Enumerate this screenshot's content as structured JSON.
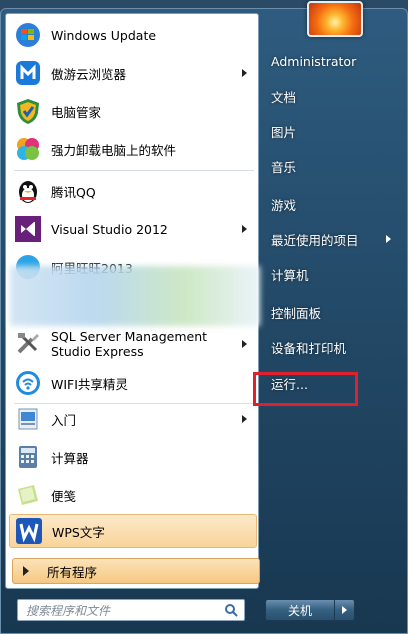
{
  "left_menu": {
    "items": [
      {
        "label": "Windows Update",
        "icon": "windows-update-icon"
      },
      {
        "label": "傲游云浏览器",
        "icon": "maxthon-browser-icon"
      },
      {
        "label": "电脑管家",
        "icon": "pc-manager-shield-icon"
      },
      {
        "label": "强力卸载电脑上的软件",
        "icon": "uninstall-petals-icon"
      },
      {
        "label": "腾讯QQ",
        "icon": "qq-penguin-icon"
      },
      {
        "label": "Visual Studio 2012",
        "icon": "visual-studio-icon"
      },
      {
        "label": "阿里旺旺2013",
        "icon": "aliwangwang-icon"
      },
      {
        "label": "SQL Server Management Studio Express",
        "icon": "sql-tools-icon"
      },
      {
        "label": "WIFI共享精灵",
        "icon": "wifi-share-icon"
      },
      {
        "label": "入门",
        "icon": "getting-started-icon"
      },
      {
        "label": "计算器",
        "icon": "calculator-icon"
      },
      {
        "label": "便笺",
        "icon": "sticky-notes-icon"
      },
      {
        "label": "WPS文字",
        "icon": "wps-writer-icon"
      }
    ],
    "all_programs": "所有程序",
    "search_placeholder": "搜索程序和文件"
  },
  "right_menu": {
    "items": [
      {
        "label": "Administrator"
      },
      {
        "label": "文档"
      },
      {
        "label": "图片"
      },
      {
        "label": "音乐"
      },
      {
        "label": "游戏"
      },
      {
        "label": "最近使用的项目"
      },
      {
        "label": "计算机"
      },
      {
        "label": "控制面板"
      },
      {
        "label": "设备和打印机"
      },
      {
        "label": "运行..."
      }
    ],
    "shutdown_label": "关机"
  },
  "colors": {
    "highlight_box": "#e0202a",
    "menu_blue": "#2e5c80"
  }
}
